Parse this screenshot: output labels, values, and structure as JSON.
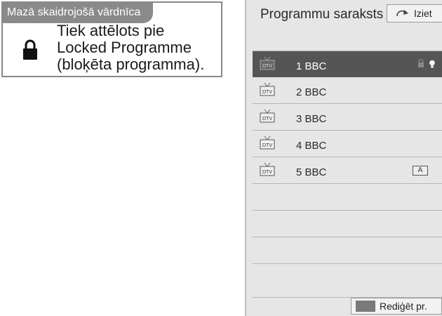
{
  "glossary": {
    "title": "Mazā skaidrojošā vārdnīca",
    "lines": [
      "Tiek attēlots pie",
      "Locked Programme",
      "(bloķēta programma)."
    ],
    "icon": "lock-icon"
  },
  "programme_list": {
    "title": "Programmu saraksts",
    "exit_label": "Iziet",
    "channels": [
      {
        "name": "1 BBC",
        "tag": "DTV",
        "selected": true,
        "icons": [
          "lock-icon",
          "favourite-icon"
        ]
      },
      {
        "name": "2 BBC",
        "tag": "DTV",
        "selected": false,
        "icons": []
      },
      {
        "name": "3 BBC",
        "tag": "DTV",
        "selected": false,
        "icons": []
      },
      {
        "name": "4 BBC",
        "tag": "DTV",
        "selected": false,
        "icons": []
      },
      {
        "name": "5 BBC",
        "tag": "DTV",
        "selected": false,
        "icons": [
          "audio-text-icon"
        ],
        "icon_text": "A"
      }
    ],
    "edit_label": "Rediģēt pr.",
    "edit_color": "#7a7a7a"
  },
  "colors": {
    "panel_bg": "#e6e6e6",
    "selected_row": "#555555",
    "glossary_title_bg": "#8a8a8a"
  }
}
